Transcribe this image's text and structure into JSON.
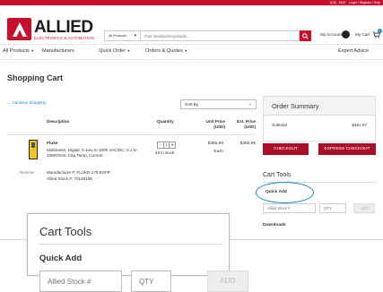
{
  "utility_bar": {
    "region": "USA - ENG",
    "login": "Login / Register / Help"
  },
  "brand": {
    "name": "ALLIED",
    "tagline": "ELECTRONICS & AUTOMATION"
  },
  "search": {
    "category": "All Products",
    "placeholder": "Part Number/Keywords"
  },
  "account": {
    "label": "My Account",
    "cart_label": "My Cart",
    "cart_count": "0"
  },
  "nav": {
    "items": [
      "All Products",
      "Manufacturers",
      "Quick Order",
      "Orders & Quotes"
    ],
    "right": "Expert Advice"
  },
  "page_title": "Shopping Cart",
  "continue_link": "Continue Shopping",
  "sort": {
    "value": "Sort By"
  },
  "table": {
    "headers": {
      "description": "Description",
      "quantity": "Quantity",
      "unit_price": "Unit Price (USD)",
      "ext_price": "Ext. Price (USD)"
    },
    "item": {
      "brand": "Fluke",
      "description": "Multimeter, Digital, 0.1mv to 1000 VAC/DC, 0.1 to 10MOhms, Cap,Temp, Current",
      "qty": "1",
      "stock": "49 In stock",
      "unit_price": "$385.99",
      "unit_label": "Each",
      "ext_price": "$385.99",
      "remove": "Remove",
      "mfr": "Manufacturer #: FLUKE-179 ESFP",
      "allied_stock": "Allied Stock #: 70146158"
    }
  },
  "summary": {
    "title": "Order Summary",
    "subtotal_label": "Subtotal",
    "subtotal_value": "$481.97",
    "checkout": "CHECKOUT",
    "express": "EXPRESS CHECKOUT"
  },
  "cart_tools": {
    "title": "Cart Tools",
    "quick_add": "Quick Add",
    "stock_placeholder": "Allied Stock #",
    "qty_placeholder": "QTY",
    "add": "ADD",
    "downloads": "Downloads"
  },
  "colors": {
    "brand_red": "#c8102e",
    "link_blue": "#1e88c7"
  }
}
